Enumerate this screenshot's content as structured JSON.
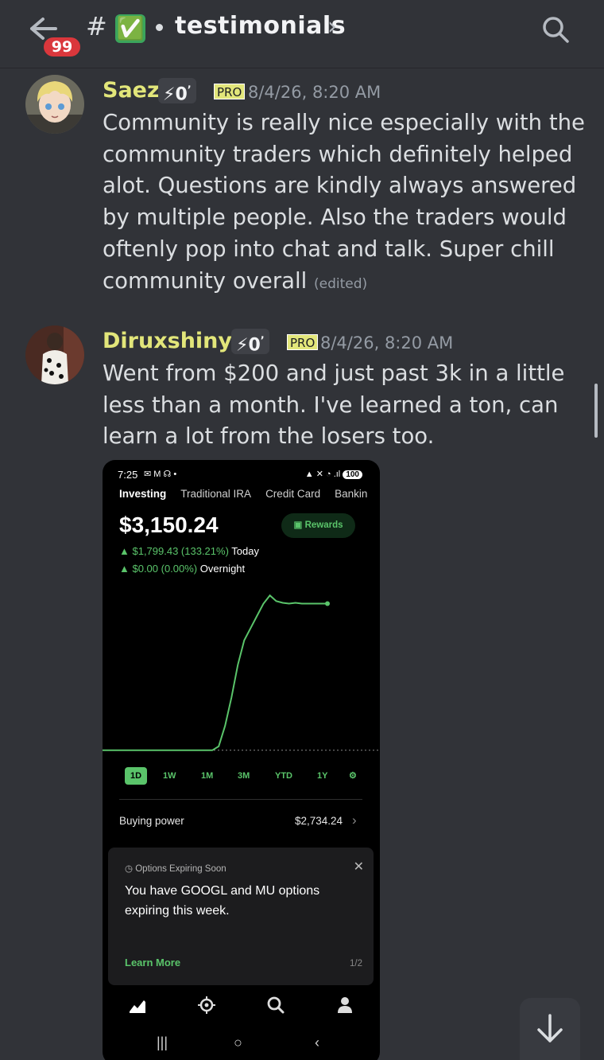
{
  "header": {
    "unread_count": "99",
    "hash": "#",
    "channel_emoji": "✅",
    "channel_name": "testimonials",
    "chevron": "›",
    "icons": [
      "back-arrow-icon",
      "search-icon"
    ]
  },
  "messages": [
    {
      "username": "Saez",
      "tag": "⚡0",
      "tag_sup": "ʼ",
      "pro": "PRO",
      "timestamp": "8/4/26, 8:20 AM",
      "text": "Community is really nice especially with the community traders which definitely helped alot. Questions are kindly always answered by multiple people. Also the traders would oftenly pop into chat and talk. Super chill community overall",
      "edited": "(edited)"
    },
    {
      "username": "Diruxshinya",
      "tag": "⚡0",
      "tag_sup": "ʼ",
      "pro": "PRO",
      "timestamp": "8/4/26, 8:20 AM",
      "text": "Went from $200 and just past 3k in a little less than a month. I've learned a ton, can learn a lot from the losers too."
    }
  ],
  "attachment": {
    "status_time": "7:25",
    "status_icons": "✉ M ☊ •",
    "battery": "100",
    "tabs": [
      "Investing",
      "Traditional IRA",
      "Credit Card",
      "Bankin"
    ],
    "balance": "$3,150.24",
    "rewards_label": "Rewards",
    "today_change": "▲ $1,799.43 (133.21%)",
    "today_label": "Today",
    "overnight_change": "▲ $0.00 (0.00%)",
    "overnight_label": "Overnight",
    "ranges": [
      "1D",
      "1W",
      "1M",
      "3M",
      "YTD",
      "1Y"
    ],
    "buying_power_label": "Buying power",
    "buying_power_value": "$2,734.24",
    "card_title": "Options Expiring Soon",
    "card_text": "You have GOOGL and MU options expiring this week.",
    "card_link": "Learn More",
    "card_page": "1/2",
    "chart_color": "#5ac46a"
  },
  "chart_data": {
    "type": "line",
    "title": "",
    "xlabel": "",
    "ylabel": "",
    "range": "1D",
    "x": [
      0,
      1,
      2,
      3,
      4,
      5,
      6,
      7,
      8,
      9,
      10,
      11,
      12,
      13,
      14,
      15,
      16,
      17,
      18,
      19,
      20
    ],
    "values": [
      1351,
      1351,
      1351,
      1400,
      1650,
      2000,
      2400,
      2700,
      2850,
      3000,
      3150,
      3250,
      3180,
      3160,
      3150,
      3160,
      3150,
      3150,
      3150,
      3150,
      3150
    ],
    "baseline": 1351
  },
  "jump_icon": "arrow-down-icon"
}
